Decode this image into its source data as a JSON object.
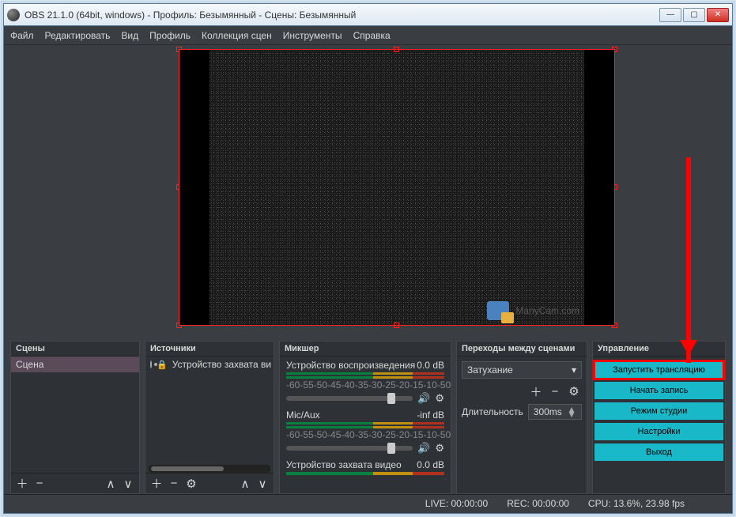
{
  "window": {
    "title": "OBS 21.1.0 (64bit, windows) - Профиль: Безымянный - Сцены: Безымянный"
  },
  "menu": {
    "file": "Файл",
    "edit": "Редактировать",
    "view": "Вид",
    "profile": "Профиль",
    "scenes": "Коллекция сцен",
    "tools": "Инструменты",
    "help": "Справка"
  },
  "watermark": "ManyCam.com",
  "docks": {
    "scenes": "Сцены",
    "sources": "Источники",
    "mixer": "Микшер",
    "transitions": "Переходы между сценами",
    "controls": "Управление"
  },
  "scenes": {
    "items": [
      "Сцена"
    ]
  },
  "sources": {
    "items": [
      "Устройство захвата ви"
    ]
  },
  "mixer": {
    "ticks": [
      "-60",
      "-55",
      "-50",
      "-45",
      "-40",
      "-35",
      "-30",
      "-25",
      "-20",
      "-15",
      "-10",
      "-5",
      "0"
    ],
    "ch": [
      {
        "name": "Устройство воспроизведения",
        "level": "0.0 dB"
      },
      {
        "name": "Mic/Aux",
        "level": "-inf dB"
      },
      {
        "name": "Устройство захвата видео",
        "level": "0.0 dB"
      }
    ]
  },
  "transitions": {
    "selected": "Затухание",
    "duration_label": "Длительность",
    "duration_value": "300ms"
  },
  "controls": {
    "stream": "Запустить трансляцию",
    "record": "Начать запись",
    "studio": "Режим студии",
    "settings": "Настройки",
    "exit": "Выход"
  },
  "status": {
    "live": "LIVE: 00:00:00",
    "rec": "REC: 00:00:00",
    "cpu": "CPU: 13.6%, 23.98 fps"
  }
}
